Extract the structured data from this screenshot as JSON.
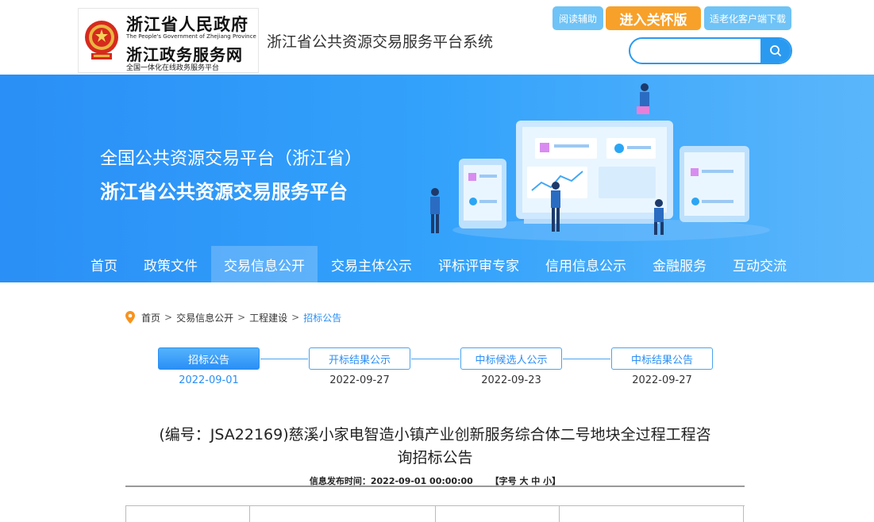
{
  "header": {
    "gov_name": "浙江省人民政府",
    "gov_en": "The People's Government of Zhejiang Province",
    "service_name": "浙江政务服务网",
    "service_sub": "全国一体化在线政务服务平台",
    "site_title": "浙江省公共资源交易服务平台系统",
    "btn_read": "阅读辅助",
    "btn_care": "进入关怀版",
    "btn_download": "适老化客户端下载",
    "search_placeholder": "",
    "search_icon": "search-icon"
  },
  "banner": {
    "line1": "全国公共资源交易平台（浙江省）",
    "line2": "浙江省公共资源交易服务平台"
  },
  "nav": {
    "items": [
      "首页",
      "政策文件",
      "交易信息公开",
      "交易主体公示",
      "评标评审专家",
      "信用信息公示",
      "金融服务",
      "互动交流"
    ],
    "active_index": 2
  },
  "breadcrumb": {
    "items": [
      "首页",
      "交易信息公开",
      "工程建设",
      "招标公告"
    ],
    "separator": ">"
  },
  "steps": [
    {
      "label": "招标公告",
      "date": "2022-09-01",
      "active": true
    },
    {
      "label": "开标结果公示",
      "date": "2022-09-27",
      "active": false
    },
    {
      "label": "中标候选人公示",
      "date": "2022-09-23",
      "active": false
    },
    {
      "label": "中标结果公告",
      "date": "2022-09-27",
      "active": false
    }
  ],
  "article": {
    "title_line1": "(编号：JSA22169)慈溪小家电智造小镇产业创新服务综合体二号地块全过程工程咨",
    "title_line2": "询招标公告",
    "meta_label": "信息发布时间：",
    "meta_time": "2022-09-01 00:00:00",
    "font_size_label": "【字号 大 中 小】"
  },
  "colors": {
    "primary": "#2a8ff6",
    "accent_orange": "#f7a12a",
    "light_blue": "#6fc3f6"
  }
}
